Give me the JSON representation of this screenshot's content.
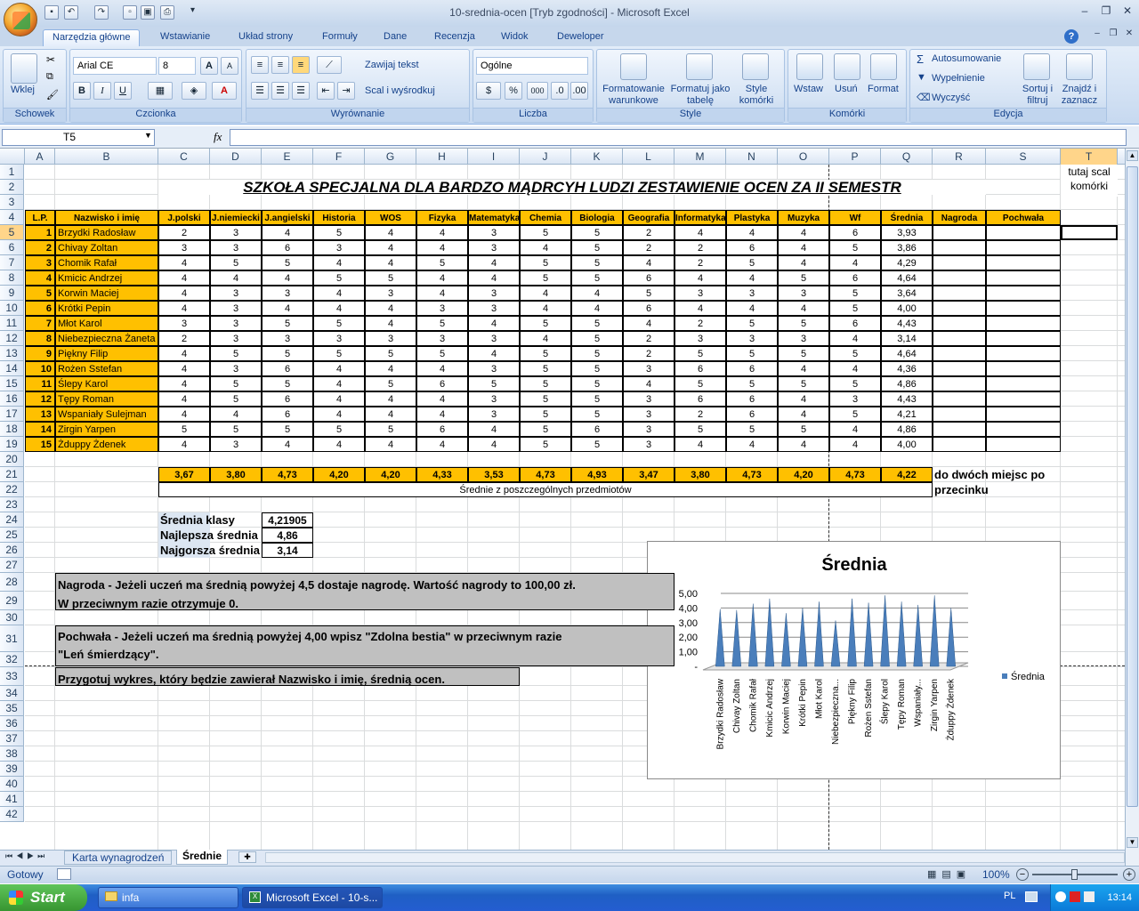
{
  "window": {
    "title": "10-srednia-ocen  [Tryb zgodności] - Microsoft Excel"
  },
  "ribbon": {
    "tabs": [
      "Narzędzia główne",
      "Wstawianie",
      "Układ strony",
      "Formuły",
      "Dane",
      "Recenzja",
      "Widok",
      "Deweloper"
    ],
    "groups": {
      "schowek": "Schowek",
      "czcionka": "Czcionka",
      "wyrownanie": "Wyrównanie",
      "liczba": "Liczba",
      "style": "Style",
      "komorki": "Komórki",
      "edycja": "Edycja"
    },
    "paste": "Wklej",
    "font_name": "Arial CE",
    "font_size": "8",
    "wrap": "Zawijaj tekst",
    "merge": "Scal i wyśrodkuj",
    "number_format": "Ogólne",
    "cond_format": "Formatowanie warunkowe",
    "format_table": "Formatuj jako tabelę",
    "cell_style": "Style komórki",
    "insert": "Wstaw",
    "delete": "Usuń",
    "format": "Format",
    "autosum": "Autosumowanie",
    "fill": "Wypełnienie",
    "clear": "Wyczyść",
    "sort": "Sortuj i filtruj",
    "find": "Znajdź i zaznacz"
  },
  "formula_bar": {
    "name_box": "T5",
    "fx": "fx"
  },
  "columns": [
    "A",
    "B",
    "C",
    "D",
    "E",
    "F",
    "G",
    "H",
    "I",
    "J",
    "K",
    "L",
    "M",
    "N",
    "O",
    "P",
    "Q",
    "R",
    "S",
    "T"
  ],
  "rows": [
    "1",
    "2",
    "3",
    "4",
    "5",
    "6",
    "7",
    "8",
    "9",
    "10",
    "11",
    "12",
    "13",
    "14",
    "15",
    "16",
    "17",
    "18",
    "19",
    "20",
    "21",
    "22",
    "23",
    "24",
    "25",
    "26",
    "27",
    "28",
    "29",
    "30",
    "31",
    "32",
    "33",
    "34",
    "35",
    "36",
    "37",
    "38",
    "39",
    "40",
    "41",
    "42"
  ],
  "sheet": {
    "title": "SZKOŁA SPECJALNA DLA BARDZO MĄDRCYH LUDZI ZESTAWIENIE OCEN ZA II SEMESTR",
    "side_note": "tutaj scal komórki",
    "headers": [
      "L.P.",
      "Nazwisko i imię",
      "J.polski",
      "J.niemiecki",
      "J.angielski",
      "Historia",
      "WOS",
      "Fizyka",
      "Matematyka",
      "Chemia",
      "Biologia",
      "Geografia",
      "Informatyka",
      "Plastyka",
      "Muzyka",
      "Wf",
      "Średnia",
      "Nagroda",
      "Pochwała"
    ],
    "students": [
      {
        "lp": "1",
        "name": "Brzydki Radosław",
        "grades": [
          "2",
          "3",
          "4",
          "5",
          "4",
          "4",
          "3",
          "5",
          "5",
          "2",
          "4",
          "4",
          "4",
          "6"
        ],
        "avg": "3,93"
      },
      {
        "lp": "2",
        "name": "Chivay Zoltan",
        "grades": [
          "3",
          "3",
          "6",
          "3",
          "4",
          "4",
          "3",
          "4",
          "5",
          "2",
          "2",
          "6",
          "4",
          "5"
        ],
        "avg": "3,86"
      },
      {
        "lp": "3",
        "name": "Chomik Rafał",
        "grades": [
          "4",
          "5",
          "5",
          "4",
          "4",
          "5",
          "4",
          "5",
          "5",
          "4",
          "2",
          "5",
          "4",
          "4"
        ],
        "avg": "4,29"
      },
      {
        "lp": "4",
        "name": "Kmicic Andrzej",
        "grades": [
          "4",
          "4",
          "4",
          "5",
          "5",
          "4",
          "4",
          "5",
          "5",
          "6",
          "4",
          "4",
          "5",
          "6"
        ],
        "avg": "4,64"
      },
      {
        "lp": "5",
        "name": "Korwin Maciej",
        "grades": [
          "4",
          "3",
          "3",
          "4",
          "3",
          "4",
          "3",
          "4",
          "4",
          "5",
          "3",
          "3",
          "3",
          "5"
        ],
        "avg": "3,64"
      },
      {
        "lp": "6",
        "name": "Krótki Pepin",
        "grades": [
          "4",
          "3",
          "4",
          "4",
          "4",
          "3",
          "3",
          "4",
          "4",
          "6",
          "4",
          "4",
          "4",
          "5"
        ],
        "avg": "4,00"
      },
      {
        "lp": "7",
        "name": "Młot Karol",
        "grades": [
          "3",
          "3",
          "5",
          "5",
          "4",
          "5",
          "4",
          "5",
          "5",
          "4",
          "2",
          "5",
          "5",
          "6"
        ],
        "avg": "4,43"
      },
      {
        "lp": "8",
        "name": "Niebezpieczna Żaneta",
        "grades": [
          "2",
          "3",
          "3",
          "3",
          "3",
          "3",
          "3",
          "4",
          "5",
          "2",
          "3",
          "3",
          "3",
          "4"
        ],
        "avg": "3,14"
      },
      {
        "lp": "9",
        "name": "Piękny Filip",
        "grades": [
          "4",
          "5",
          "5",
          "5",
          "5",
          "5",
          "4",
          "5",
          "5",
          "2",
          "5",
          "5",
          "5",
          "5"
        ],
        "avg": "4,64"
      },
      {
        "lp": "10",
        "name": "Rożen Sstefan",
        "grades": [
          "4",
          "3",
          "6",
          "4",
          "4",
          "4",
          "3",
          "5",
          "5",
          "3",
          "6",
          "6",
          "4",
          "4"
        ],
        "avg": "4,36"
      },
      {
        "lp": "11",
        "name": "Ślepy Karol",
        "grades": [
          "4",
          "5",
          "5",
          "4",
          "5",
          "6",
          "5",
          "5",
          "5",
          "4",
          "5",
          "5",
          "5",
          "5"
        ],
        "avg": "4,86"
      },
      {
        "lp": "12",
        "name": "Tępy Roman",
        "grades": [
          "4",
          "5",
          "6",
          "4",
          "4",
          "4",
          "3",
          "5",
          "5",
          "3",
          "6",
          "6",
          "4",
          "3"
        ],
        "avg": "4,43"
      },
      {
        "lp": "13",
        "name": "Wspaniały Sulejman",
        "grades": [
          "4",
          "4",
          "6",
          "4",
          "4",
          "4",
          "3",
          "5",
          "5",
          "3",
          "2",
          "6",
          "4",
          "5"
        ],
        "avg": "4,21"
      },
      {
        "lp": "14",
        "name": "Zirgin Yarpen",
        "grades": [
          "5",
          "5",
          "5",
          "5",
          "5",
          "6",
          "4",
          "5",
          "6",
          "3",
          "5",
          "5",
          "5",
          "4"
        ],
        "avg": "4,86"
      },
      {
        "lp": "15",
        "name": "Żduppy Żdenek",
        "grades": [
          "4",
          "3",
          "4",
          "4",
          "4",
          "4",
          "4",
          "5",
          "5",
          "3",
          "4",
          "4",
          "4",
          "4"
        ],
        "avg": "4,00"
      }
    ],
    "subject_avgs": [
      "3,67",
      "3,80",
      "4,73",
      "4,20",
      "4,20",
      "4,33",
      "3,53",
      "4,73",
      "4,93",
      "3,47",
      "3,80",
      "4,73",
      "4,20",
      "4,73",
      "4,22"
    ],
    "subject_avg_label": "Średnie z poszczególnych przedmiotów",
    "precision_note_1": "do dwóch miejsc po",
    "precision_note_2": "przecinku",
    "stats": [
      {
        "label": "Średnia klasy",
        "value": "4,21905"
      },
      {
        "label": "Najlepsza średnia",
        "value": "4,86"
      },
      {
        "label": "Najgorsza średnia",
        "value": "3,14"
      }
    ],
    "note_prize_1": "Nagroda - Jeżeli uczeń ma średnią powyżej 4,5 dostaje nagrodę. Wartość nagrody to 100,00 zł.",
    "note_prize_2": "W przeciwnym razie otrzymuje 0.",
    "note_praise_1": "Pochwała - Jeżeli uczeń ma średnią powyżej 4,00 wpisz \"Zdolna bestia\" w przeciwnym razie",
    "note_praise_2": "\"Leń śmierdzący\".",
    "note_chart": "Przygotuj wykres, który będzie zawierał Nazwisko i imię, średnią ocen."
  },
  "chart_data": {
    "type": "area",
    "title": "Średnia",
    "categories": [
      "Brzydki Radosław",
      "Chivay Zoltan",
      "Chomik Rafał",
      "Kmicic Andrzej",
      "Korwin Maciej",
      "Krótki Pepin",
      "Młot Karol",
      "Niebezpieczna...",
      "Piękny Filip",
      "Rożen Sstefan",
      "Ślepy Karol",
      "Tępy Roman",
      "Wspaniały...",
      "Zirgin Yarpen",
      "Żduppy Żdenek"
    ],
    "series": [
      {
        "name": "Średnia",
        "values": [
          3.93,
          3.86,
          4.29,
          4.64,
          3.64,
          4.0,
          4.43,
          3.14,
          4.64,
          4.36,
          4.86,
          4.43,
          4.21,
          4.86,
          4.0
        ]
      }
    ],
    "ylim": [
      0,
      5
    ],
    "yticks": [
      "5,00",
      "4,00",
      "3,00",
      "2,00",
      "1,00",
      "-"
    ],
    "legend": "right",
    "color": "#4a7ebb"
  },
  "sheet_tabs": [
    "Karta wynagrodzeń",
    "Średnie"
  ],
  "status": {
    "ready": "Gotowy",
    "zoom": "100%"
  },
  "taskbar": {
    "start": "Start",
    "items": [
      "infa",
      "Microsoft Excel - 10-s..."
    ],
    "lang": "PL",
    "clock": "13:14"
  }
}
